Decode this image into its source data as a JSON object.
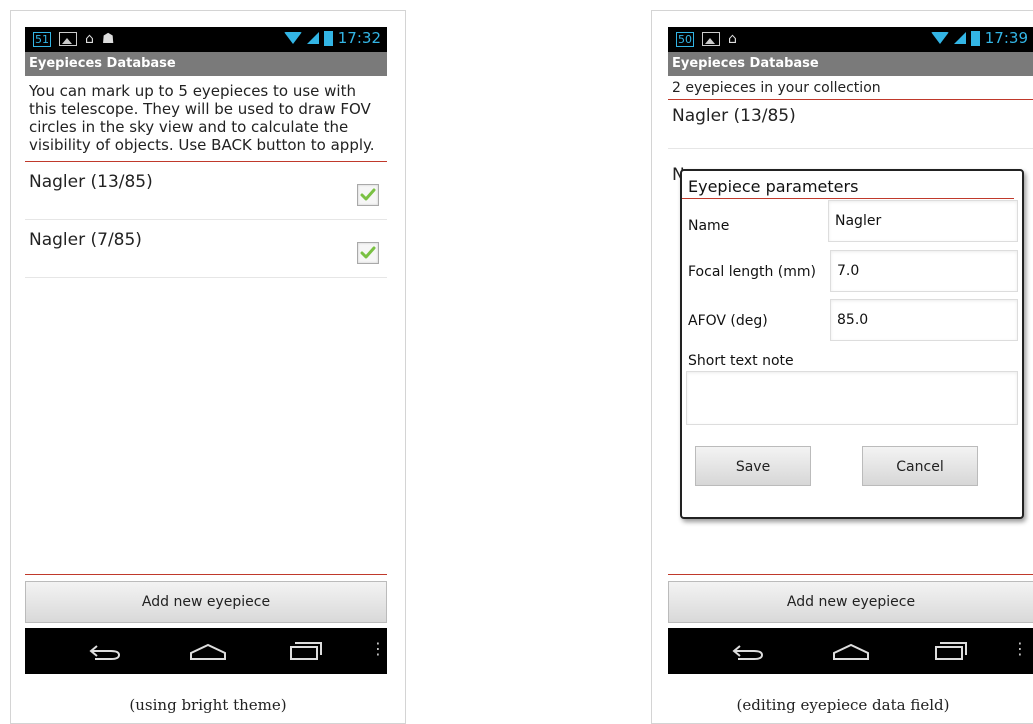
{
  "left": {
    "statusbar": {
      "notif_count": "51",
      "time": "17:32"
    },
    "title": "Eyepieces Database",
    "intro": "You can mark up to 5 eyepieces to use with this telescope. They will be used to draw FOV circles in the sky view and to calculate the visibility of objects. Use BACK button to apply.",
    "items": [
      {
        "label": "Nagler (13/85)",
        "checked": true
      },
      {
        "label": "Nagler (7/85)",
        "checked": true
      }
    ],
    "add_button": "Add new eyepiece",
    "caption": "(using bright theme)"
  },
  "right": {
    "statusbar": {
      "notif_count": "50",
      "time": "17:39"
    },
    "title": "Eyepieces Database",
    "subtitle": "2 eyepieces in your collection",
    "items": [
      {
        "label": "Nagler (13/85)"
      },
      {
        "label": "N"
      }
    ],
    "dialog": {
      "title": "Eyepiece parameters",
      "name_label": "Name",
      "name_value": "Nagler",
      "focal_label": "Focal length (mm)",
      "focal_value": "7.0",
      "afov_label": "AFOV (deg)",
      "afov_value": "85.0",
      "note_label": "Short text note",
      "note_value": "",
      "save": "Save",
      "cancel": "Cancel"
    },
    "add_button": "Add new eyepiece",
    "caption": "(editing eyepiece data field)"
  },
  "colors": {
    "accent": "#33b5e5",
    "divider": "#c0392b",
    "titlebar": "#7a7a7a",
    "check": "#7ac143"
  },
  "icons": [
    "image-icon",
    "home-icon",
    "android-icon",
    "wifi-icon",
    "signal-icon",
    "battery-icon",
    "back-icon",
    "home-nav-icon",
    "recent-apps-icon",
    "menu-icon",
    "checkmark-icon"
  ]
}
